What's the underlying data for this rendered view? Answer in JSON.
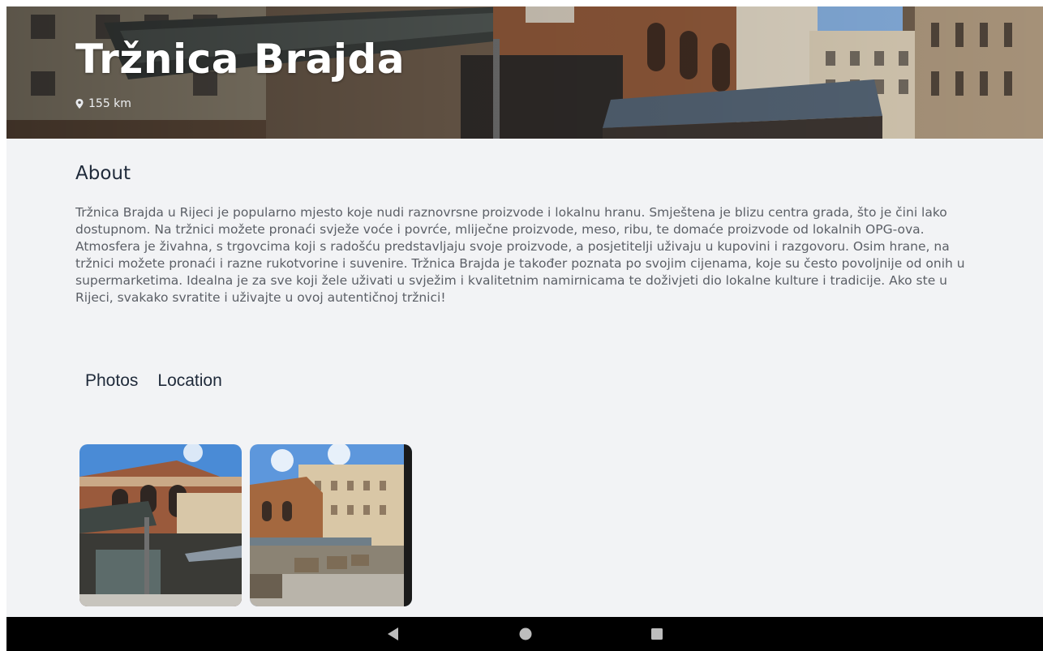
{
  "place": {
    "title": "Tržnica Brajda",
    "distance": "155 km",
    "pin_icon": "location-pin-icon"
  },
  "about": {
    "heading": "About",
    "paragraph_1": "Tržnica Brajda u Rijeci je popularno mjesto koje nudi raznovrsne proizvode i lokalnu hranu. Smještena je blizu centra grada, što je čini lako dostupnom. Na tržnici možete pronaći svježe voće i povrće, mliječne proizvode, meso, ribu, te domaće proizvode od lokalnih OPG-ova.",
    "paragraph_2": "Atmosfera je živahna, s trgovcima koji s radošću predstavljaju svoje proizvode, a posjetitelji uživaju u kupovini i razgovoru. Osim hrane, na tržnici možete pronaći i razne rukotvorine i suvenire. Tržnica Brajda je također poznata po svojim cijenama, koje su često povoljnije od onih u supermarketima. Idealna je za sve koji žele uživati u svježim i kvalitetnim namirnicama te doživjeti dio lokalne kulture i tradicije. Ako ste u Rijeci, svakako svratite i uživajte u ovoj autentičnoj tržnici!"
  },
  "tabs": [
    {
      "label": "Photos"
    },
    {
      "label": "Location"
    }
  ],
  "photos": [
    {
      "description": "market-hall-photo"
    },
    {
      "description": "market-square-photo"
    }
  ],
  "navbar": {
    "back_icon": "back-triangle-icon",
    "home_icon": "home-circle-icon",
    "recents_icon": "recents-square-icon"
  },
  "colors": {
    "background": "#f2f3f5",
    "heading": "#1f2a3a",
    "body_text": "#5b5f66",
    "navbar": "#000000"
  }
}
